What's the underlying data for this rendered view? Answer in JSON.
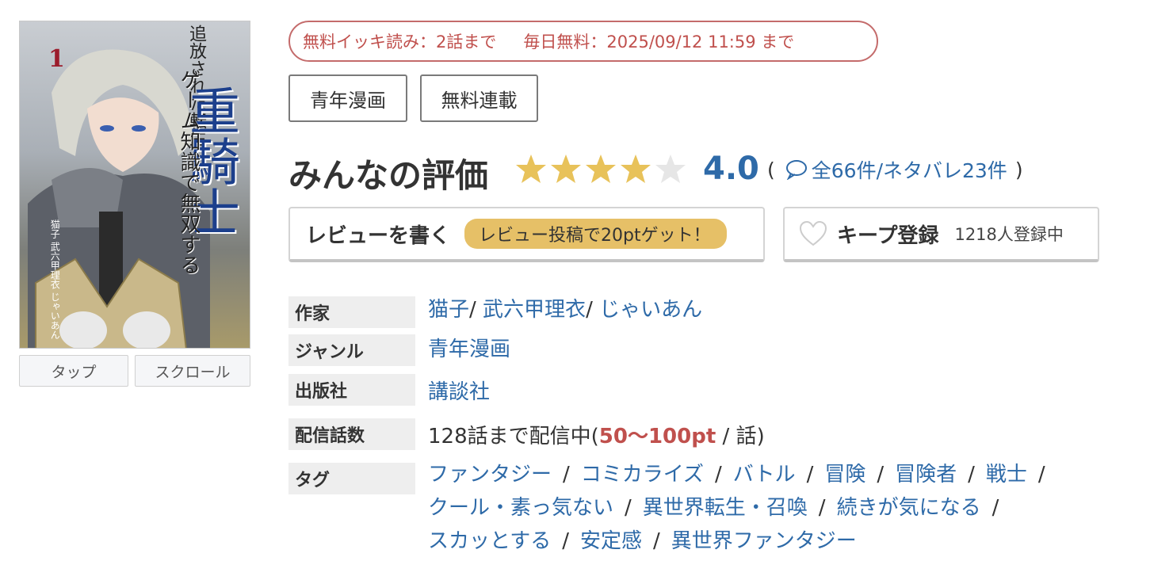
{
  "cover": {
    "volume": "1",
    "title_top": "追放された転生",
    "title_main": "重騎士",
    "title_sub": "ゲーム知識で無双する",
    "credits": "猫子 武六甲理衣 じゃいあん"
  },
  "viewer": {
    "tap": "タップ",
    "scroll": "スクロール"
  },
  "free": {
    "ikki": "無料イッキ読み：2話まで",
    "daily": "毎日無料：2025/09/12 11:59 まで"
  },
  "genre_tags": [
    "青年漫画",
    "無料連載"
  ],
  "rating": {
    "title": "みんなの評価",
    "score": "4.0",
    "stars": 4,
    "open_paren": "(",
    "reviews_link": "全66件/ネタバレ23件",
    "close_paren": ")",
    "color_filled": "#e8c25a",
    "color_empty": "#e6e6e6"
  },
  "actions": {
    "review_label": "レビューを書く",
    "review_promo": "レビュー投稿で20ptゲット！",
    "keep_label": "キープ登録",
    "keep_count": "1218人登録中"
  },
  "info": {
    "author_label": "作家",
    "authors": [
      "猫子",
      "武六甲理衣",
      "じゃいあん"
    ],
    "genre_label": "ジャンル",
    "genre": "青年漫画",
    "publisher_label": "出版社",
    "publisher": "講談社",
    "episodes_label": "配信話数",
    "episodes_prefix": "128話まで配信中(",
    "episodes_price": "50〜100pt",
    "episodes_suffix": " / 話)",
    "tags_label": "タグ",
    "tags": [
      "ファンタジー",
      "コミカライズ",
      "バトル",
      "冒険",
      "冒険者",
      "戦士",
      "クール・素っ気ない",
      "異世界転生・召喚",
      "続きが気になる",
      "スカッとする",
      "安定感",
      "異世界ファンタジー"
    ]
  }
}
